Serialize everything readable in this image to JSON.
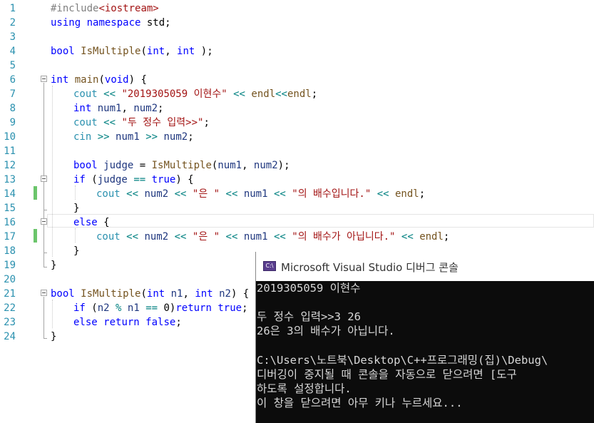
{
  "editor": {
    "line_numbers": [
      "1",
      "2",
      "3",
      "4",
      "5",
      "6",
      "7",
      "8",
      "9",
      "10",
      "11",
      "12",
      "13",
      "14",
      "15",
      "16",
      "17",
      "18",
      "19",
      "20",
      "21",
      "22",
      "23",
      "24"
    ],
    "lines": [
      {
        "indent": 0,
        "tokens": [
          [
            "pp",
            "#include"
          ],
          [
            "str",
            "<iostream>"
          ]
        ]
      },
      {
        "indent": 0,
        "tokens": [
          [
            "kw",
            "using"
          ],
          [
            "t",
            " "
          ],
          [
            "kw",
            "namespace"
          ],
          [
            "t",
            " std;"
          ]
        ]
      },
      {
        "indent": 0,
        "tokens": []
      },
      {
        "indent": 0,
        "tokens": [
          [
            "kw",
            "bool"
          ],
          [
            "t",
            " "
          ],
          [
            "fn",
            "IsMultiple"
          ],
          [
            "t",
            "("
          ],
          [
            "kw",
            "int"
          ],
          [
            "t",
            ", "
          ],
          [
            "kw",
            "int"
          ],
          [
            "t",
            " );"
          ]
        ]
      },
      {
        "indent": 0,
        "tokens": []
      },
      {
        "indent": 0,
        "tokens": [
          [
            "kw",
            "int"
          ],
          [
            "t",
            " "
          ],
          [
            "fn",
            "main"
          ],
          [
            "t",
            "("
          ],
          [
            "kw",
            "void"
          ],
          [
            "t",
            ") {"
          ]
        ]
      },
      {
        "indent": 1,
        "tokens": [
          [
            "cls",
            "cout"
          ],
          [
            "t",
            " "
          ],
          [
            "op",
            "<<"
          ],
          [
            "t",
            " "
          ],
          [
            "str",
            "\"2019305059 이현수\""
          ],
          [
            "t",
            " "
          ],
          [
            "op",
            "<<"
          ],
          [
            "t",
            " "
          ],
          [
            "fn",
            "endl"
          ],
          [
            "op",
            "<<"
          ],
          [
            "fn",
            "endl"
          ],
          [
            "t",
            ";"
          ]
        ]
      },
      {
        "indent": 1,
        "tokens": [
          [
            "kw",
            "int"
          ],
          [
            "t",
            " "
          ],
          [
            "var",
            "num1"
          ],
          [
            "t",
            ", "
          ],
          [
            "var",
            "num2"
          ],
          [
            "t",
            ";"
          ]
        ]
      },
      {
        "indent": 1,
        "tokens": [
          [
            "cls",
            "cout"
          ],
          [
            "t",
            " "
          ],
          [
            "op",
            "<<"
          ],
          [
            "t",
            " "
          ],
          [
            "str",
            "\"두 정수 입력>>\""
          ],
          [
            "t",
            ";"
          ]
        ]
      },
      {
        "indent": 1,
        "tokens": [
          [
            "cls",
            "cin"
          ],
          [
            "t",
            " "
          ],
          [
            "op",
            ">>"
          ],
          [
            "t",
            " "
          ],
          [
            "var",
            "num1"
          ],
          [
            "t",
            " "
          ],
          [
            "op",
            ">>"
          ],
          [
            "t",
            " "
          ],
          [
            "var",
            "num2"
          ],
          [
            "t",
            ";"
          ]
        ]
      },
      {
        "indent": 0,
        "tokens": []
      },
      {
        "indent": 1,
        "tokens": [
          [
            "kw",
            "bool"
          ],
          [
            "t",
            " "
          ],
          [
            "var",
            "judge"
          ],
          [
            "t",
            " = "
          ],
          [
            "fn",
            "IsMultiple"
          ],
          [
            "t",
            "("
          ],
          [
            "var",
            "num1"
          ],
          [
            "t",
            ", "
          ],
          [
            "var",
            "num2"
          ],
          [
            "t",
            ");"
          ]
        ]
      },
      {
        "indent": 1,
        "tokens": [
          [
            "kw",
            "if"
          ],
          [
            "t",
            " ("
          ],
          [
            "var",
            "judge"
          ],
          [
            "t",
            " "
          ],
          [
            "op",
            "=="
          ],
          [
            "t",
            " "
          ],
          [
            "kw",
            "true"
          ],
          [
            "t",
            ") {"
          ]
        ]
      },
      {
        "indent": 2,
        "tokens": [
          [
            "cls",
            "cout"
          ],
          [
            "t",
            " "
          ],
          [
            "op",
            "<<"
          ],
          [
            "t",
            " "
          ],
          [
            "var",
            "num2"
          ],
          [
            "t",
            " "
          ],
          [
            "op",
            "<<"
          ],
          [
            "t",
            " "
          ],
          [
            "str",
            "\"은 \""
          ],
          [
            "t",
            " "
          ],
          [
            "op",
            "<<"
          ],
          [
            "t",
            " "
          ],
          [
            "var",
            "num1"
          ],
          [
            "t",
            " "
          ],
          [
            "op",
            "<<"
          ],
          [
            "t",
            " "
          ],
          [
            "str",
            "\"의 배수입니다.\""
          ],
          [
            "t",
            " "
          ],
          [
            "op",
            "<<"
          ],
          [
            "t",
            " "
          ],
          [
            "fn",
            "endl"
          ],
          [
            "t",
            ";"
          ]
        ]
      },
      {
        "indent": 1,
        "tokens": [
          [
            "t",
            "}"
          ]
        ]
      },
      {
        "indent": 1,
        "tokens": [
          [
            "kw",
            "else"
          ],
          [
            "t",
            " {"
          ]
        ]
      },
      {
        "indent": 2,
        "tokens": [
          [
            "cls",
            "cout"
          ],
          [
            "t",
            " "
          ],
          [
            "op",
            "<<"
          ],
          [
            "t",
            " "
          ],
          [
            "var",
            "num2"
          ],
          [
            "t",
            " "
          ],
          [
            "op",
            "<<"
          ],
          [
            "t",
            " "
          ],
          [
            "str",
            "\"은 \""
          ],
          [
            "t",
            " "
          ],
          [
            "op",
            "<<"
          ],
          [
            "t",
            " "
          ],
          [
            "var",
            "num1"
          ],
          [
            "t",
            " "
          ],
          [
            "op",
            "<<"
          ],
          [
            "t",
            " "
          ],
          [
            "str",
            "\"의 배수가 아닙니다.\""
          ],
          [
            "t",
            " "
          ],
          [
            "op",
            "<<"
          ],
          [
            "t",
            " "
          ],
          [
            "fn",
            "endl"
          ],
          [
            "t",
            ";"
          ]
        ]
      },
      {
        "indent": 1,
        "tokens": [
          [
            "t",
            "}"
          ]
        ]
      },
      {
        "indent": 0,
        "tokens": [
          [
            "t",
            "}"
          ]
        ]
      },
      {
        "indent": 0,
        "tokens": []
      },
      {
        "indent": 0,
        "tokens": [
          [
            "kw",
            "bool"
          ],
          [
            "t",
            " "
          ],
          [
            "fn",
            "IsMultiple"
          ],
          [
            "t",
            "("
          ],
          [
            "kw",
            "int"
          ],
          [
            "t",
            " "
          ],
          [
            "var",
            "n1"
          ],
          [
            "t",
            ", "
          ],
          [
            "kw",
            "int"
          ],
          [
            "t",
            " "
          ],
          [
            "var",
            "n2"
          ],
          [
            "t",
            ") {"
          ]
        ]
      },
      {
        "indent": 1,
        "tokens": [
          [
            "kw",
            "if"
          ],
          [
            "t",
            " ("
          ],
          [
            "var",
            "n2"
          ],
          [
            "t",
            " "
          ],
          [
            "op",
            "%"
          ],
          [
            "t",
            " "
          ],
          [
            "var",
            "n1"
          ],
          [
            "t",
            " "
          ],
          [
            "op",
            "=="
          ],
          [
            "t",
            " 0)"
          ],
          [
            "kw",
            "return"
          ],
          [
            "t",
            " "
          ],
          [
            "kw",
            "true"
          ],
          [
            "t",
            ";"
          ]
        ]
      },
      {
        "indent": 1,
        "tokens": [
          [
            "kw",
            "else"
          ],
          [
            "t",
            " "
          ],
          [
            "kw",
            "return"
          ],
          [
            "t",
            " "
          ],
          [
            "kw",
            "false"
          ],
          [
            "t",
            ";"
          ]
        ]
      },
      {
        "indent": 0,
        "tokens": [
          [
            "t",
            "}"
          ]
        ]
      }
    ]
  },
  "console": {
    "icon_label": "C:\\",
    "title": "Microsoft Visual Studio 디버그 콘솔",
    "lines": [
      "2019305059 이현수",
      "",
      "두 정수 입력>>3 26",
      "26은 3의 배수가 아닙니다.",
      "",
      "C:\\Users\\노트북\\Desktop\\C++프로그래밍(집)\\Debug\\",
      "디버깅이 중지될 때 콘솔을 자동으로 닫으려면 [도구",
      "하도록 설정합니다.",
      "이 창을 닫으려면 아무 키나 누르세요..."
    ]
  }
}
